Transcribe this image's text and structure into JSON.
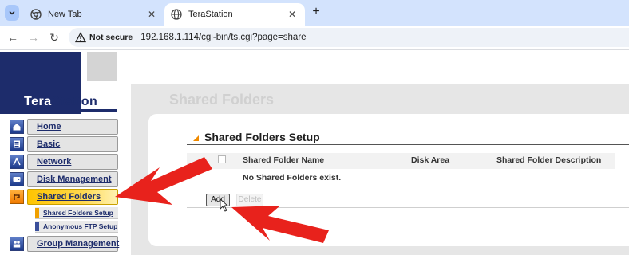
{
  "browser": {
    "tabs": [
      {
        "title": "New Tab",
        "active": false
      },
      {
        "title": "TeraStation",
        "active": true
      }
    ],
    "new_tab_symbol": "+",
    "close_symbol": "✕",
    "nav": {
      "back": "←",
      "forward": "→",
      "reload": "↻"
    },
    "security_label": "Not secure",
    "url": "192.168.1.114/cgi-bin/ts.cgi?page=share"
  },
  "logo": {
    "part1": "Tera",
    "part2": "Station"
  },
  "sidebar": {
    "items": [
      {
        "label": "Home",
        "icon": "home-icon"
      },
      {
        "label": "Basic",
        "icon": "basic-settings-icon"
      },
      {
        "label": "Network",
        "icon": "network-icon"
      },
      {
        "label": "Disk Management",
        "icon": "disk-icon"
      },
      {
        "label": "Shared Folders",
        "icon": "shared-folder-icon",
        "selected": true
      },
      {
        "label": "Group Management",
        "icon": "group-icon"
      }
    ],
    "sub_items": [
      {
        "label": "Shared Folders Setup",
        "mark_color": "#f0a000"
      },
      {
        "label": "Anonymous FTP Setup",
        "mark_color": "#3a4f9a"
      }
    ]
  },
  "main": {
    "page_title": "Shared Folders",
    "section_title": "Shared Folders Setup",
    "columns": [
      "Shared Folder Name",
      "Disk Area",
      "Shared Folder Description"
    ],
    "empty_message": "No Shared Folders exist.",
    "buttons": {
      "add": "Add",
      "delete": "Delete"
    }
  },
  "annotations": {
    "arrow_color": "#e8221c",
    "arrow_count": 2
  },
  "colors": {
    "tab_strip": "#d3e3fd",
    "brand_navy": "#1d2c6b",
    "selected_menu": "#ffc400",
    "section_marker": "#f08a00"
  }
}
